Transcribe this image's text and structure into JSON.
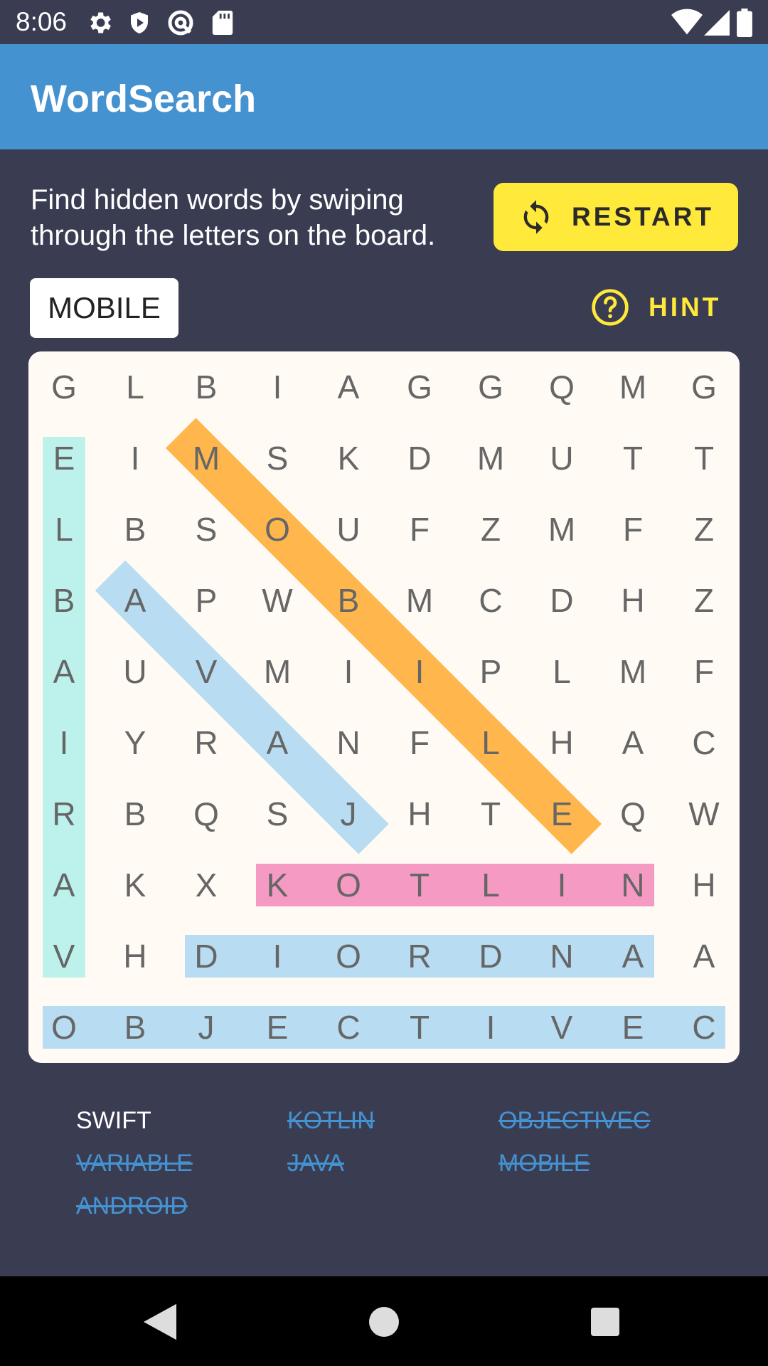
{
  "status_bar": {
    "time": "8:06",
    "icons": [
      "settings-icon",
      "shield-icon",
      "at-sign-icon",
      "sd-card-icon",
      "wifi-icon",
      "signal-icon",
      "battery-icon"
    ]
  },
  "app_bar": {
    "title": "WordSearch"
  },
  "instructions": "Find hidden words by swiping through the letters on the board.",
  "restart": {
    "label": "RESTART",
    "icon": "refresh-icon"
  },
  "current_word": "MOBILE",
  "hint": {
    "label": "HINT",
    "icon": "help-circle-icon"
  },
  "colors": {
    "background": "#3a3c52",
    "app_bar": "#4592d1",
    "accent_yellow": "#ffe93a",
    "board": "#fffbf4",
    "highlight_teal": "#bdf2ec",
    "highlight_orange": "#ffb74d",
    "highlight_blue": "#b8dcf1",
    "highlight_pink": "#f49ac3"
  },
  "grid": [
    [
      "G",
      "L",
      "B",
      "I",
      "A",
      "G",
      "G",
      "Q",
      "M",
      "G"
    ],
    [
      "E",
      "I",
      "M",
      "S",
      "K",
      "D",
      "M",
      "U",
      "T",
      "T"
    ],
    [
      "L",
      "B",
      "S",
      "O",
      "U",
      "F",
      "Z",
      "M",
      "F",
      "Z"
    ],
    [
      "B",
      "A",
      "P",
      "W",
      "B",
      "M",
      "C",
      "D",
      "H",
      "Z"
    ],
    [
      "A",
      "U",
      "V",
      "M",
      "I",
      "I",
      "P",
      "L",
      "M",
      "F"
    ],
    [
      "I",
      "Y",
      "R",
      "A",
      "N",
      "F",
      "L",
      "H",
      "A",
      "C"
    ],
    [
      "R",
      "B",
      "Q",
      "S",
      "J",
      "H",
      "T",
      "E",
      "Q",
      "W"
    ],
    [
      "A",
      "K",
      "X",
      "K",
      "O",
      "T",
      "L",
      "I",
      "N",
      "H"
    ],
    [
      "V",
      "H",
      "D",
      "I",
      "O",
      "R",
      "D",
      "N",
      "A",
      "A"
    ],
    [
      "O",
      "B",
      "J",
      "E",
      "C",
      "T",
      "I",
      "V",
      "E",
      "C"
    ]
  ],
  "found_words": [
    {
      "word": "VARIABLE",
      "color": "#bdf2ec",
      "start": [
        8,
        0
      ],
      "end": [
        1,
        0
      ]
    },
    {
      "word": "MOBILE",
      "color": "#ffb74d",
      "start": [
        1,
        2
      ],
      "end": [
        6,
        7
      ]
    },
    {
      "word": "JAVA",
      "color": "#b8dcf1",
      "start": [
        6,
        4
      ],
      "end": [
        3,
        1
      ]
    },
    {
      "word": "KOTLIN",
      "color": "#f49ac3",
      "start": [
        7,
        3
      ],
      "end": [
        7,
        8
      ]
    },
    {
      "word": "ANDROID",
      "color": "#b8dcf1",
      "start": [
        8,
        8
      ],
      "end": [
        8,
        2
      ]
    },
    {
      "word": "OBJECTIVEC",
      "color": "#b8dcf1",
      "start": [
        9,
        0
      ],
      "end": [
        9,
        9
      ]
    }
  ],
  "word_list": [
    {
      "text": "SWIFT",
      "found": false
    },
    {
      "text": "KOTLIN",
      "found": true
    },
    {
      "text": "OBJECTIVEC",
      "found": true
    },
    {
      "text": "VARIABLE",
      "found": true
    },
    {
      "text": "JAVA",
      "found": true
    },
    {
      "text": "MOBILE",
      "found": true
    },
    {
      "text": "ANDROID",
      "found": true
    }
  ],
  "nav_bar": {
    "icons": [
      "back-icon",
      "home-icon",
      "recents-icon"
    ]
  }
}
